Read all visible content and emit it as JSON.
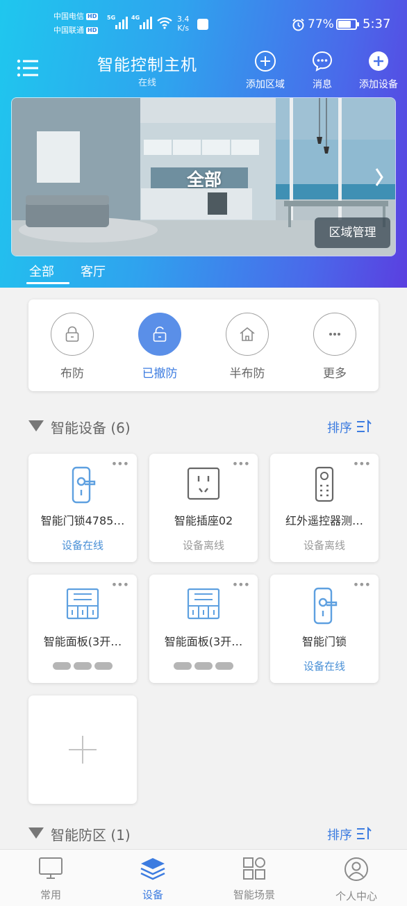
{
  "status_bar": {
    "carrier1": "中国电信",
    "carrier2": "中国联通",
    "hd": "HD",
    "net1": "5G",
    "net2": "4G",
    "net_rate": "3.4",
    "net_unit": "K/s",
    "battery_level": 0.77,
    "battery_text": "77%",
    "time": "5:37"
  },
  "header": {
    "title": "智能控制主机",
    "subtitle": "在线",
    "add_area": "添加区域",
    "messages": "消息",
    "add_device": "添加设备"
  },
  "banner": {
    "label": "全部",
    "area_manage": "区域管理"
  },
  "room_tabs": [
    {
      "label": "全部",
      "active": true
    },
    {
      "label": "客厅",
      "active": false
    }
  ],
  "modes": [
    {
      "label": "布防",
      "icon": "lock-closed-icon",
      "active": false
    },
    {
      "label": "已撤防",
      "icon": "lock-open-icon",
      "active": true
    },
    {
      "label": "半布防",
      "icon": "home-icon",
      "active": false
    },
    {
      "label": "更多",
      "icon": "more-icon",
      "active": false
    }
  ],
  "devices_section": {
    "title": "智能设备 (6)",
    "sort": "排序"
  },
  "devices": [
    {
      "name": "智能门锁4785…",
      "status": "设备在线",
      "icon": "door-lock-icon",
      "online": true
    },
    {
      "name": "智能插座02",
      "status": "设备离线",
      "icon": "socket-icon",
      "online": false
    },
    {
      "name": "红外遥控器测…",
      "status": "设备离线",
      "icon": "ir-remote-icon",
      "online": false
    },
    {
      "name": "智能面板(3开…",
      "status": "",
      "icon": "switch-panel-icon",
      "online": false
    },
    {
      "name": "智能面板(3开…",
      "status": "",
      "icon": "switch-panel-icon",
      "online": false
    },
    {
      "name": "智能门锁",
      "status": "设备在线",
      "icon": "door-lock-icon",
      "online": true
    }
  ],
  "zones_section": {
    "title": "智能防区 (1)",
    "sort": "排序"
  },
  "bottom_nav": [
    {
      "label": "常用",
      "icon": "monitor-icon",
      "active": false
    },
    {
      "label": "设备",
      "icon": "layers-icon",
      "active": true
    },
    {
      "label": "智能场景",
      "icon": "grid-icon",
      "active": false
    },
    {
      "label": "个人中心",
      "icon": "user-icon",
      "active": false
    }
  ],
  "colors": {
    "accent": "#3d7ce0",
    "online": "#4a90d6",
    "offline": "#999999",
    "header_start": "#1fc7ee",
    "header_end": "#5a3fe0"
  }
}
